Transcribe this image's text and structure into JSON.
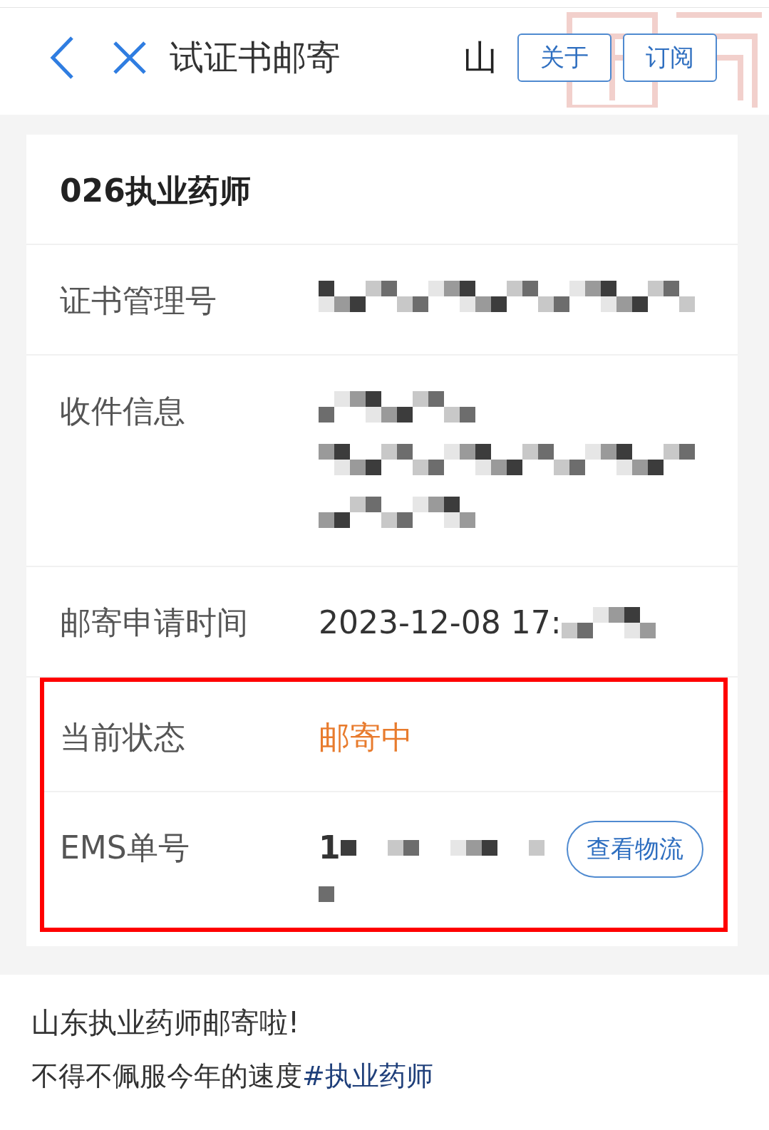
{
  "header": {
    "title": "试证书邮寄",
    "subtitle": "山",
    "buttons": [
      "关于",
      "订阅"
    ]
  },
  "card": {
    "title": "026执业药师",
    "rows": [
      {
        "label": "证书管理号",
        "kind": "mosaic",
        "highlighted": false
      },
      {
        "label": "收件信息",
        "kind": "mosaic-block",
        "highlighted": false
      },
      {
        "label": "邮寄申请时间",
        "kind": "partial",
        "value": "2023-12-08 17:",
        "highlighted": false
      },
      {
        "label": "当前状态",
        "kind": "status",
        "value": "邮寄中",
        "highlighted": true
      },
      {
        "label": "EMS单号",
        "kind": "tracking",
        "value": "1",
        "action": "查看物流",
        "highlighted": true
      }
    ]
  },
  "post": {
    "text": "山东执业药师邮寄啦!",
    "caption": "不得不佩服今年的速度",
    "tag": "#执业药师"
  }
}
